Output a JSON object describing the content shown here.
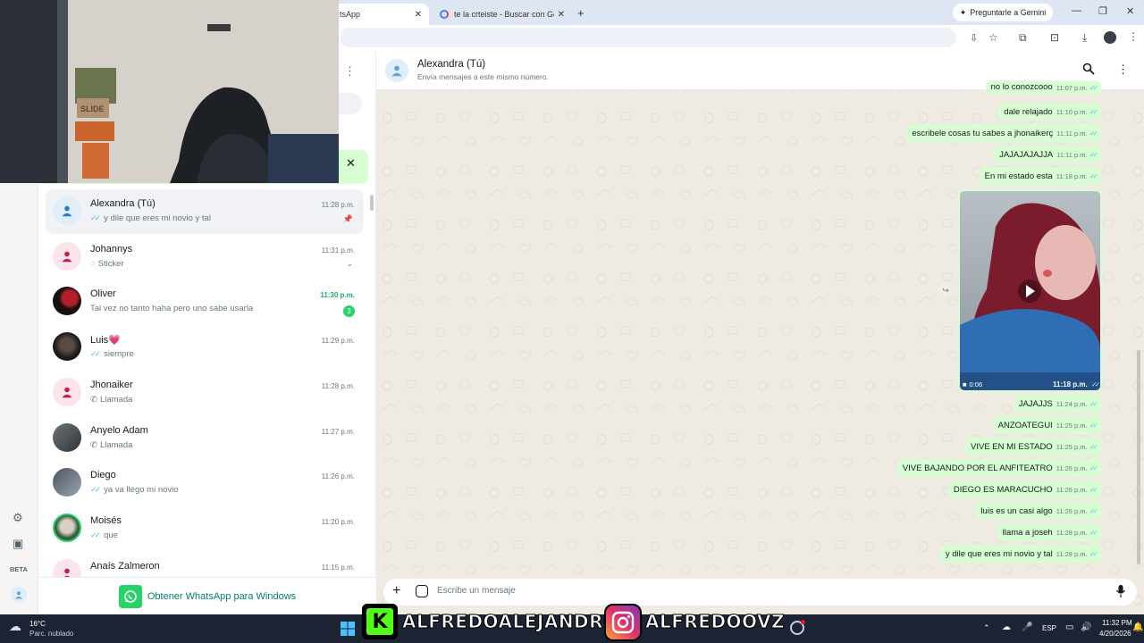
{
  "browser": {
    "tabs": [
      {
        "title": "tsApp"
      },
      {
        "title": "te la crteiste - Buscar con Goog"
      }
    ],
    "gemini_label": "Preguntarle a Gemini"
  },
  "nav": {
    "beta_label": "BETA"
  },
  "chats": [
    {
      "name": "Alexandra (Tú)",
      "preview": "y dile que eres mi novio y tal",
      "time": "11:28 p.m.",
      "ticks": true,
      "pinned": true,
      "avatar": "default-blue"
    },
    {
      "name": "Johannys",
      "preview": "Sticker",
      "time": "11:31 p.m.",
      "prefix_icon": "sticker-icon",
      "avatar": "default-pink"
    },
    {
      "name": "Oliver",
      "preview": "Tal vez no tanto haha pero uno sabe usarla",
      "time": "11:30 p.m.",
      "unread": "3",
      "avatar": "photo-dark-red"
    },
    {
      "name": "Luis💗",
      "preview": "siempre",
      "time": "11:29 p.m.",
      "ticks": true,
      "avatar": "photo-dark"
    },
    {
      "name": "Jhonaiker",
      "preview": "Llamada",
      "time": "11:28 p.m.",
      "prefix_icon": "call-icon",
      "avatar": "default-pink"
    },
    {
      "name": "Anyelo Adam",
      "preview": "Llamada",
      "time": "11:27 p.m.",
      "prefix_icon": "call-icon",
      "avatar": "photo-gray"
    },
    {
      "name": "Diego",
      "preview": "ya va llego mi novio",
      "time": "11:26 p.m.",
      "ticks": true,
      "avatar": "photo-gray2"
    },
    {
      "name": "Moisés",
      "preview": "que",
      "time": "11:20 p.m.",
      "ticks": true,
      "avatar": "photo-green"
    },
    {
      "name": "Anaís Zalmeron",
      "preview": "",
      "time": "11:15 p.m.",
      "avatar": "default-pink"
    }
  ],
  "get_app_label": "Obtener WhatsApp para Windows",
  "conversation": {
    "contact_name": "Alexandra (Tú)",
    "contact_sub": "Envía mensajes a este mismo número.",
    "messages": [
      {
        "text": "no lo conozcooo",
        "time": "11:07 p.m."
      },
      {
        "text": "dale relajado",
        "time": "11:10 p.m."
      },
      {
        "text": "escribele cosas tu sabes a jhonaikerç",
        "time": "11:11 p.m."
      },
      {
        "text": "JAJAJAJAJJA",
        "time": "11:11 p.m."
      },
      {
        "text": "En mi estado esta",
        "time": "11:18 p.m."
      },
      {
        "text": "JAJAJJS",
        "time": "11:24 p.m."
      },
      {
        "text": "ANZOATEGUI",
        "time": "11:25 p.m."
      },
      {
        "text": "VIVE EN MI ESTADO",
        "time": "11:25 p.m."
      },
      {
        "text": "VIVE BAJANDO POR EL ANFITEATRO",
        "time": "11:26 p.m."
      },
      {
        "text": "DIEGO ES MARACUCHO",
        "time": "11:26 p.m."
      },
      {
        "text": "luis es un casi algo",
        "time": "11:26 p.m."
      },
      {
        "text": "llama a joseh",
        "time": "11:28 p.m."
      },
      {
        "text": "y dile que eres mi novio y tal",
        "time": "11:28 p.m."
      }
    ],
    "video": {
      "duration": "0:06",
      "time": "11:18 p.m."
    },
    "composer_placeholder": "Escribe un mensaje"
  },
  "taskbar": {
    "weather_temp": "16°C",
    "weather_desc": "Parc. nublado",
    "lang": "ESP",
    "clock_time": "11:32 PM",
    "clock_date": "4/20/2026"
  },
  "overlay": {
    "brand1": "ALFREDOALEJANDROO",
    "brand2": "ALFREDOOVZ",
    "webcam_label": "SLIDE"
  },
  "colors": {
    "wa_green": "#25d366",
    "bubble_out": "#d9fdd3",
    "chat_bg": "#efeae2",
    "tick_blue": "#53bdeb"
  }
}
